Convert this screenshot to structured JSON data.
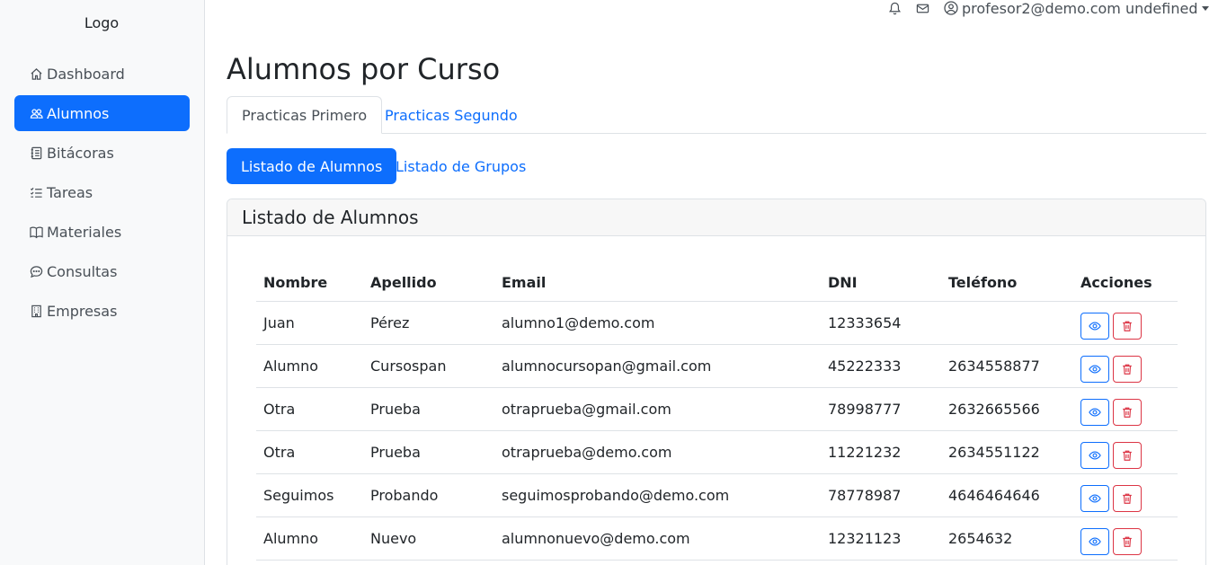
{
  "sidebar": {
    "logo": "Logo",
    "items": [
      {
        "label": "Dashboard",
        "icon": "house-icon"
      },
      {
        "label": "Alumnos",
        "icon": "people-icon",
        "active": true
      },
      {
        "label": "Bitácoras",
        "icon": "journal-icon"
      },
      {
        "label": "Tareas",
        "icon": "list-check-icon"
      },
      {
        "label": "Materiales",
        "icon": "book-icon"
      },
      {
        "label": "Consultas",
        "icon": "chat-dots-icon"
      },
      {
        "label": "Empresas",
        "icon": "building-icon"
      }
    ]
  },
  "topbar": {
    "user": "profesor2@demo.com undefined",
    "icons": [
      "bell-icon",
      "envelope-icon",
      "person-circle-icon"
    ]
  },
  "main": {
    "title": "Alumnos por Curso",
    "tabs": [
      {
        "label": "Practicas Primero",
        "active": true
      },
      {
        "label": "Practicas Segundo",
        "active": false
      }
    ],
    "pills": [
      {
        "label": "Listado de Alumnos",
        "active": true
      },
      {
        "label": "Listado de Grupos",
        "active": false
      }
    ],
    "card_title": "Listado de Alumnos",
    "table": {
      "headers": [
        "Nombre",
        "Apellido",
        "Email",
        "DNI",
        "Teléfono",
        "Acciones"
      ],
      "rows": [
        [
          "Juan",
          "Pérez",
          "alumno1@demo.com",
          "12333654",
          ""
        ],
        [
          "Alumno",
          "Cursospan",
          "alumnocursopan@gmail.com",
          "45222333",
          "2634558877"
        ],
        [
          "Otra",
          "Prueba",
          "otraprueba@gmail.com",
          "78998777",
          "2632665566"
        ],
        [
          "Otra",
          "Prueba",
          "otraprueba@demo.com",
          "11221232",
          "2634551122"
        ],
        [
          "Seguimos",
          "Probando",
          "seguimosprobando@demo.com",
          "78778987",
          "4646464646"
        ],
        [
          "Alumno",
          "Nuevo",
          "alumnonuevo@demo.com",
          "12321123",
          "2654632"
        ]
      ]
    }
  },
  "colors": {
    "primary": "#0d6efd",
    "danger": "#dc3545",
    "sidebar_bg": "#f8f9fa"
  }
}
